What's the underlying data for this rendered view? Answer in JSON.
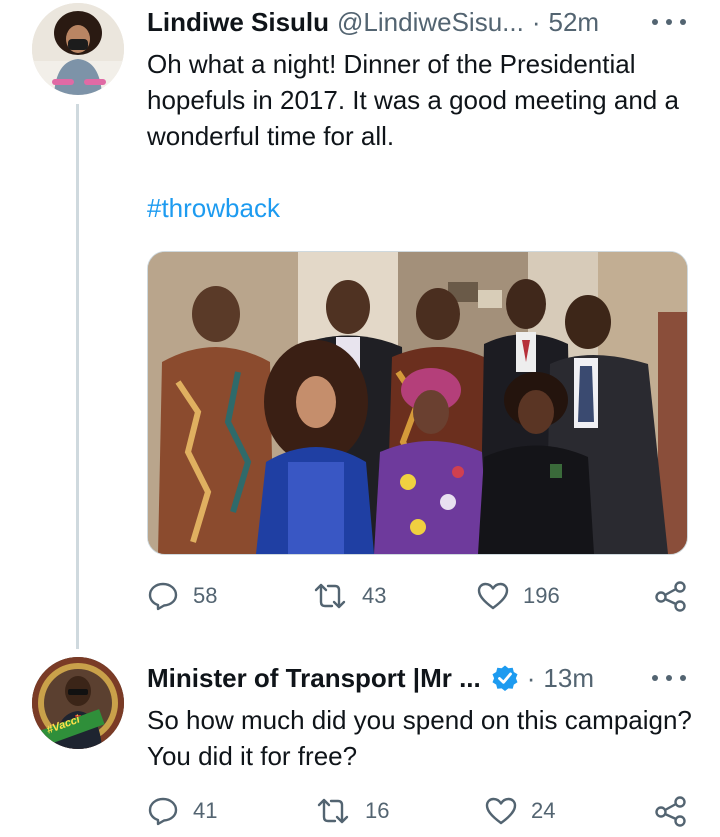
{
  "thread": [
    {
      "author": {
        "display_name": "Lindiwe Sisulu",
        "handle": "@LindiweSisu...",
        "separator": "·",
        "time": "52m",
        "verified": false,
        "avatar": "profile-photo-woman-mask"
      },
      "text": "Oh what a night! Dinner of the Presidential hopefuls in 2017. It was a good meeting and a wonderful time for all.",
      "hashtag": "#throwback",
      "media": {
        "type": "photo",
        "description": "group-photo"
      },
      "actions": {
        "reply": {
          "icon": "reply-icon",
          "count": "58"
        },
        "retweet": {
          "icon": "retweet-icon",
          "count": "43"
        },
        "like": {
          "icon": "heart-icon",
          "count": "196"
        },
        "share": {
          "icon": "share-icon"
        }
      }
    },
    {
      "author": {
        "display_name": "Minister of Transport |Mr ...",
        "separator": "·",
        "time": "13m",
        "verified": true,
        "avatar": "profile-photo-man-vaccinated-frame",
        "avatar_badge": "#Vacci"
      },
      "text": "So how much did you spend on this campaign? You did it for free?",
      "actions": {
        "reply": {
          "icon": "reply-icon",
          "count": "41"
        },
        "retweet": {
          "icon": "retweet-icon",
          "count": "16"
        },
        "like": {
          "icon": "heart-icon",
          "count": "24"
        },
        "share": {
          "icon": "share-icon"
        }
      }
    }
  ],
  "colors": {
    "text": "#0f1419",
    "secondary": "#536471",
    "link": "#1d9bf0",
    "thread_line": "#cfd9de",
    "verified": "#1d9bf0"
  }
}
